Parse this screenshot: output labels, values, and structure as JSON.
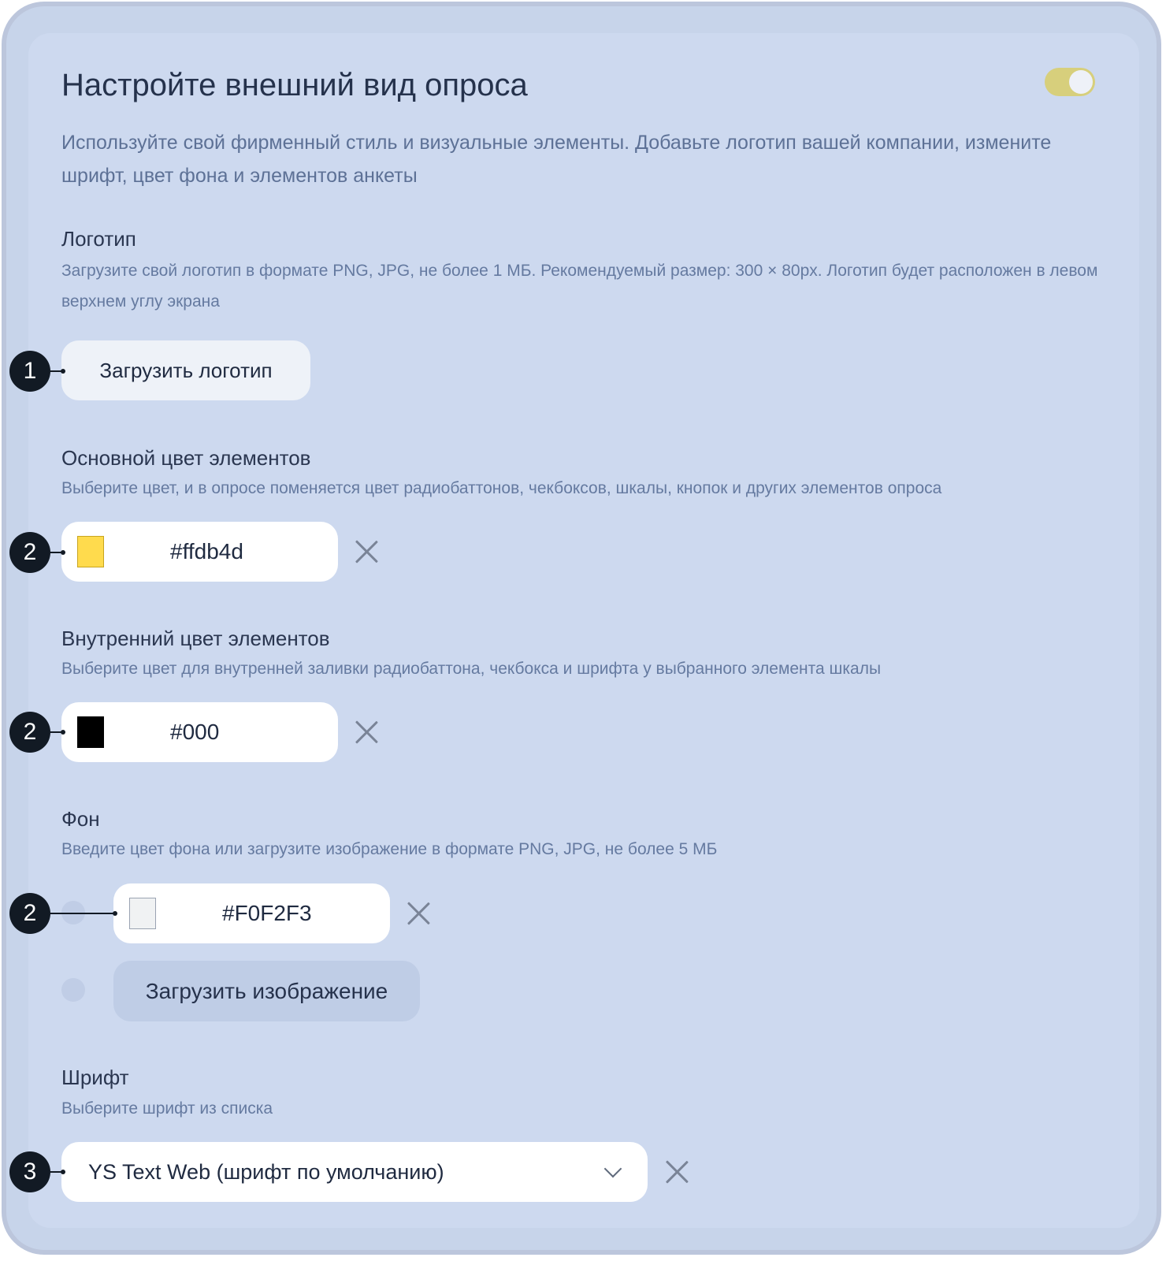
{
  "header": {
    "title": "Настройте внешний вид опроса",
    "description": "Используйте свой фирменный стиль и визуальные элементы. Добавьте логотип вашей компании, измените шрифт, цвет фона и элементов анкеты",
    "toggle_on": true
  },
  "logo": {
    "title": "Логотип",
    "description": "Загрузите свой логотип в формате PNG, JPG, не более 1 МБ. Рекомендуемый размер: 300 × 80px. Логотип будет расположен в левом верхнем углу экрана",
    "button_label": "Загрузить логотип"
  },
  "primary_color": {
    "title": "Основной цвет элементов",
    "description": "Выберите цвет, и в опросе поменяется цвет радиобаттонов, чекбоксов, шкалы, кнопок и других элементов опроса",
    "value": "#ffdb4d",
    "swatch_color": "#ffdb4d"
  },
  "inner_color": {
    "title": "Внутренний цвет элементов",
    "description": "Выберите цвет для внутренней заливки радиобаттона, чекбокса и шрифта у выбранного элемента шкалы",
    "value": "#000",
    "swatch_color": "#000000"
  },
  "background": {
    "title": "Фон",
    "description": "Введите цвет фона или загрузите изображение в формате PNG, JPG, не более 5 МБ",
    "color_value": "#F0F2F3",
    "swatch_color": "#F0F2F3",
    "upload_label": "Загрузить изображение"
  },
  "font": {
    "title": "Шрифт",
    "description": "Выберите шрифт из списка",
    "selected": "YS Text Web (шрифт по умолчанию)"
  },
  "callouts": {
    "logo": "1",
    "primary_color": "2",
    "inner_color": "2",
    "background_color": "2",
    "font": "3"
  }
}
